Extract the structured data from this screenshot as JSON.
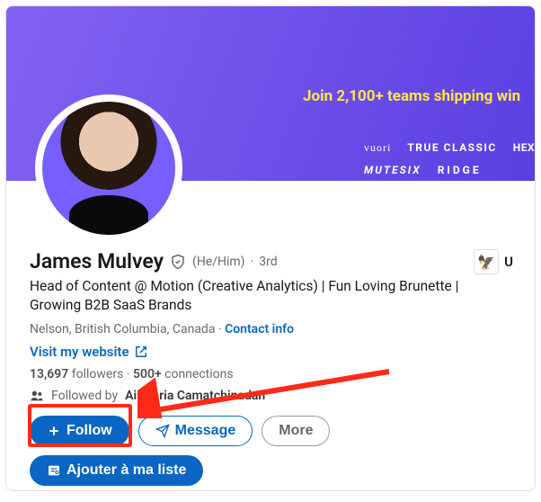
{
  "banner": {
    "headline": "Join 2,100+ teams shipping win",
    "brands_row1": [
      "vuori",
      "TRUE CLASSIC",
      "HEXCLAD"
    ],
    "brands_row2": [
      "MUTESIX",
      "RIDGE"
    ]
  },
  "profile": {
    "name": "James Mulvey",
    "pronouns": "(He/Him)",
    "degree": "3rd",
    "headline": "Head of Content @ Motion (Creative Analytics) | Fun Loving Brunette | Growing B2B SaaS Brands",
    "location": "Nelson, British Columbia, Canada",
    "contact_label": "Contact info",
    "website_label": "Visit my website",
    "followers_count": "13,697",
    "followers_label": "followers",
    "connections_count": "500+",
    "connections_label": "connections",
    "followed_by_prefix": "Followed by",
    "followed_by_name": "Aiswaria Camatchinadan"
  },
  "company": {
    "letter": "U"
  },
  "actions": {
    "follow": "Follow",
    "message": "Message",
    "more": "More",
    "add_to_list": "Ajouter à ma liste"
  }
}
